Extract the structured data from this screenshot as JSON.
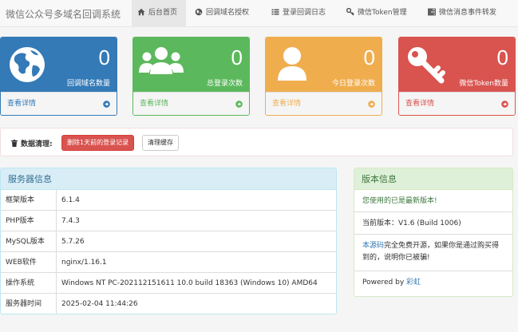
{
  "brand": "微信公众号多域名回调系统",
  "nav": [
    {
      "label": "后台首页",
      "icon": "home-icon"
    },
    {
      "label": "回调域名授权",
      "icon": "globe-icon"
    },
    {
      "label": "登录回调日志",
      "icon": "list-icon"
    },
    {
      "label": "微信Token管理",
      "icon": "key-icon"
    },
    {
      "label": "微信消息事件转发",
      "icon": "tasks-icon"
    }
  ],
  "stats": [
    {
      "value": "0",
      "label": "回调域名数量",
      "link": "查看详情",
      "color": "#337ab7",
      "icon": "globe-icon"
    },
    {
      "value": "0",
      "label": "总登录次数",
      "link": "查看详情",
      "color": "#5cb85c",
      "icon": "users-icon"
    },
    {
      "value": "0",
      "label": "今日登录次数",
      "link": "查看详情",
      "color": "#f0ad4e",
      "icon": "user-icon"
    },
    {
      "value": "0",
      "label": "微信Token数量",
      "link": "查看详情",
      "color": "#d9534f",
      "icon": "key-icon"
    }
  ],
  "cleanup": {
    "title": "数据清理:",
    "delete_btn": "删除1天前的登录记录",
    "clear_cache_btn": "清理缓存"
  },
  "server": {
    "title": "服务器信息",
    "rows": [
      {
        "k": "框架版本",
        "v": "6.1.4"
      },
      {
        "k": "PHP版本",
        "v": "7.4.3"
      },
      {
        "k": "MySQL版本",
        "v": "5.7.26"
      },
      {
        "k": "WEB软件",
        "v": "nginx/1.16.1"
      },
      {
        "k": "操作系统",
        "v": "Windows NT PC-202112151611 10.0 build 18363 (Windows 10) AMD64"
      },
      {
        "k": "服务器时间",
        "v": "2025-02-04 11:44:26"
      }
    ]
  },
  "version": {
    "title": "版本信息",
    "latest": "您使用的已是最新版本!",
    "current": "当前版本：V1.6 (Build 1006)",
    "source_link": "本源码",
    "source_text": "完全免费开源，如果你是通过购买得到的，说明你已被骗!",
    "powered_prefix": "Powered by ",
    "powered_link": "彩虹"
  },
  "colors": {
    "primary": "#337ab7",
    "success": "#5cb85c",
    "warning": "#f0ad4e",
    "danger": "#d9534f"
  }
}
